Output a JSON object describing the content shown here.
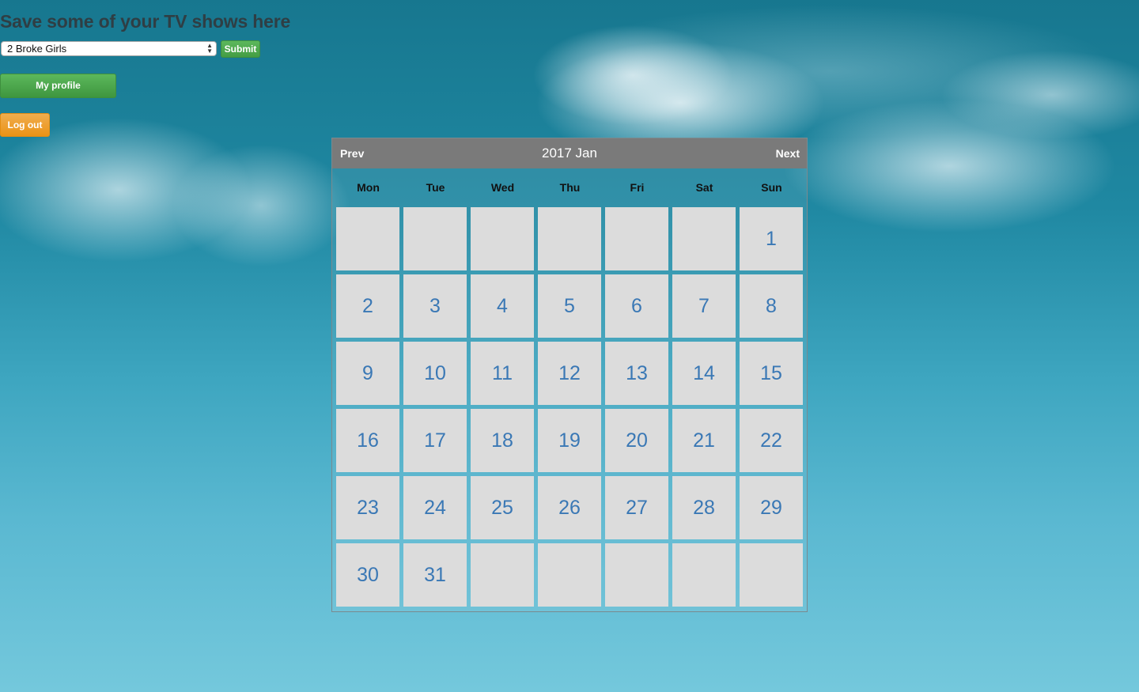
{
  "page": {
    "title": "Save some of your TV shows here"
  },
  "form": {
    "selected_show": "2 Broke Girls",
    "submit_label": "Submit"
  },
  "nav": {
    "profile_label": "My profile",
    "logout_label": "Log out"
  },
  "calendar": {
    "prev_label": "Prev",
    "next_label": "Next",
    "title": "2017 Jan",
    "weekdays": [
      "Mon",
      "Tue",
      "Wed",
      "Thu",
      "Fri",
      "Sat",
      "Sun"
    ],
    "cells": [
      "",
      "",
      "",
      "",
      "",
      "",
      "1",
      "2",
      "3",
      "4",
      "5",
      "6",
      "7",
      "8",
      "9",
      "10",
      "11",
      "12",
      "13",
      "14",
      "15",
      "16",
      "17",
      "18",
      "19",
      "20",
      "21",
      "22",
      "23",
      "24",
      "25",
      "26",
      "27",
      "28",
      "29",
      "30",
      "31",
      "",
      "",
      "",
      "",
      ""
    ]
  },
  "colors": {
    "header_bar": "#7a7a7a",
    "day_cell": "#dcdcdc",
    "day_number": "#3a78b5",
    "submit_green": "#5cb85c",
    "logout_orange": "#f0ad4e"
  }
}
